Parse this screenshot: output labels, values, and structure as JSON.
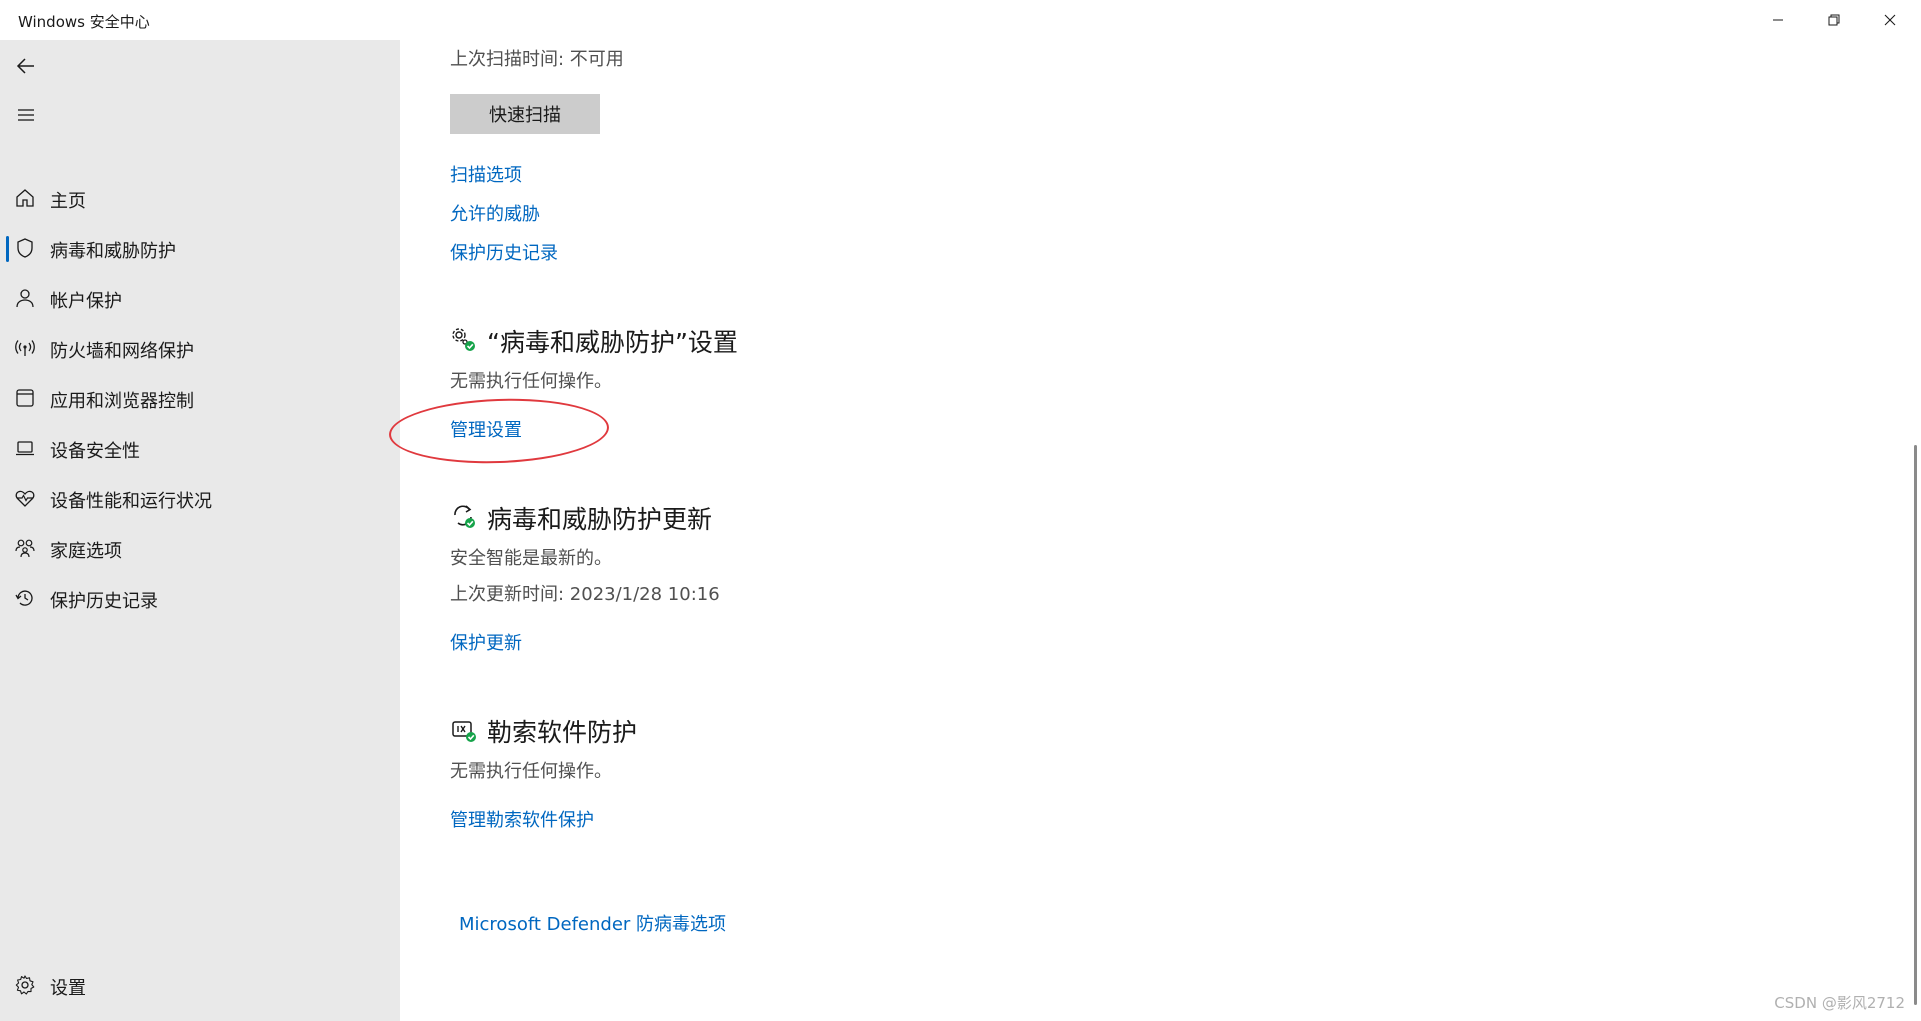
{
  "window": {
    "title": "Windows 安全中心"
  },
  "sidebar": {
    "items": [
      {
        "label": "主页",
        "icon": "home-icon"
      },
      {
        "label": "病毒和威胁防护",
        "icon": "shield-icon",
        "active": true
      },
      {
        "label": "帐户保护",
        "icon": "person-icon"
      },
      {
        "label": "防火墙和网络保护",
        "icon": "wireless-icon"
      },
      {
        "label": "应用和浏览器控制",
        "icon": "app-window-icon"
      },
      {
        "label": "设备安全性",
        "icon": "laptop-icon"
      },
      {
        "label": "设备性能和运行状况",
        "icon": "heart-pulse-icon"
      },
      {
        "label": "家庭选项",
        "icon": "family-icon"
      },
      {
        "label": "保护历史记录",
        "icon": "history-icon"
      }
    ],
    "settings_label": "设置"
  },
  "main": {
    "last_scan": "上次扫描时间: 不可用",
    "quick_scan_button": "快速扫描",
    "scan_links": [
      "扫描选项",
      "允许的威胁",
      "保护历史记录"
    ],
    "settings_section": {
      "title": "“病毒和威胁防护”设置",
      "status": "无需执行任何操作。",
      "link": "管理设置"
    },
    "updates_section": {
      "title": "病毒和威胁防护更新",
      "status": "安全智能是最新的。",
      "last_update": "上次更新时间: 2023/1/28 10:16",
      "link": "保护更新"
    },
    "ransomware_section": {
      "title": "勒索软件防护",
      "status": "无需执行任何操作。",
      "link": "管理勒索软件保护"
    },
    "defender_link": "Microsoft Defender 防病毒选项"
  },
  "watermark": "CSDN @影风2712",
  "colors": {
    "accent": "#0067c0",
    "sidebar_bg": "#e9e9e9",
    "status_ok": "#16a34a",
    "annotation": "#e0393e"
  }
}
